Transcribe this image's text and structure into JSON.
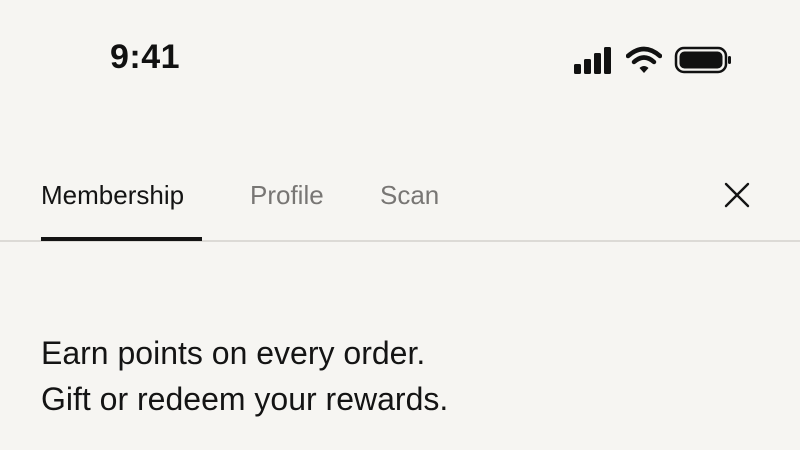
{
  "status_bar": {
    "time": "9:41",
    "icons": [
      "cellular-signal-icon",
      "wifi-icon",
      "battery-icon"
    ]
  },
  "tabs": [
    {
      "label": "Membership",
      "active": true
    },
    {
      "label": "Profile",
      "active": false
    },
    {
      "label": "Scan",
      "active": false
    }
  ],
  "close_icon": "close-icon",
  "intro": {
    "line1": "Earn points on every order.",
    "line2": "Gift or redeem your rewards."
  },
  "colors": {
    "background": "#f6f5f2",
    "text": "#141414",
    "inactive_tab": "#787674",
    "divider": "#dcdad6"
  }
}
